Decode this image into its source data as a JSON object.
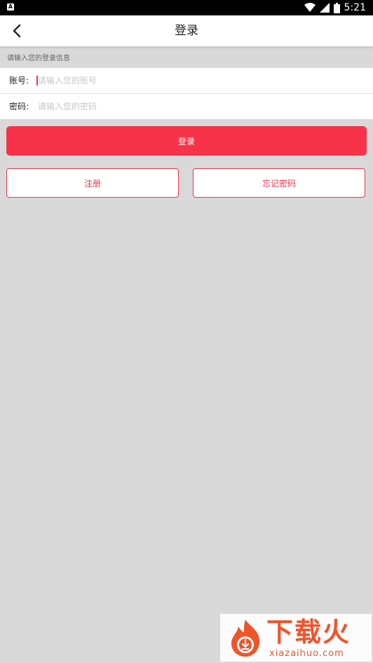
{
  "status": {
    "time": "5:21",
    "left_icon": "A"
  },
  "header": {
    "title": "登录",
    "back_icon": "chevron-left-icon"
  },
  "form": {
    "hint": "请输入您的登录信息",
    "account_label": "账号:",
    "account_placeholder": "请输入您的账号",
    "password_label": "密码:",
    "password_placeholder": "请输入您的密码"
  },
  "buttons": {
    "login": "登录",
    "register": "注册",
    "forgot": "忘记密码"
  },
  "watermark": {
    "brand": "下载火",
    "site": "xiazaihuo.com"
  },
  "colors": {
    "accent": "#f7334a",
    "background": "#d9d9d9"
  }
}
